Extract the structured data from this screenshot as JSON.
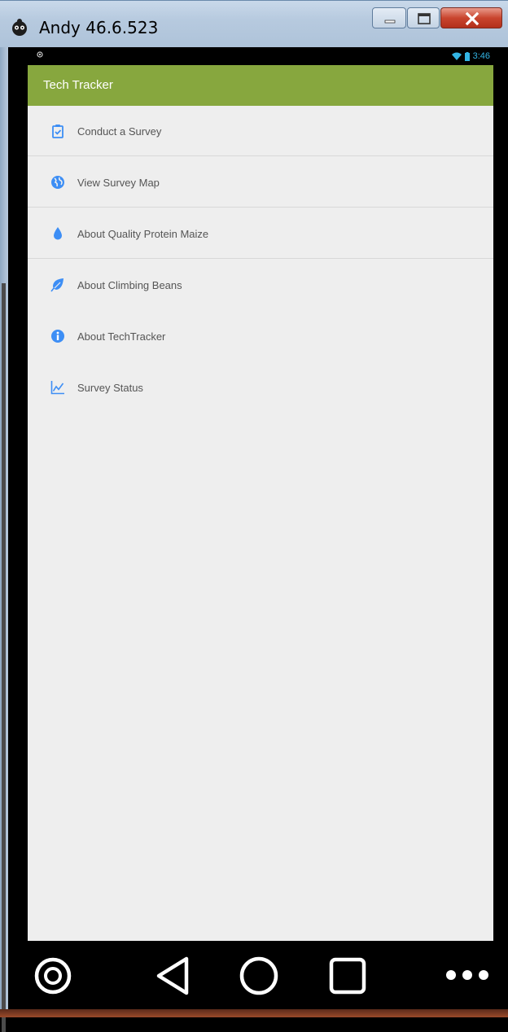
{
  "window": {
    "title": "Andy 46.6.523",
    "controls": [
      "minimize",
      "maximize",
      "close"
    ]
  },
  "statusbar": {
    "time": "3:46",
    "icons": [
      "gps-icon",
      "wifi-icon",
      "battery-icon"
    ]
  },
  "actionbar": {
    "title": "Tech Tracker",
    "color": "#87a73e"
  },
  "menu": {
    "accent_color": "#3d8ef5",
    "items": [
      {
        "label": "Conduct a Survey",
        "icon": "clipboard-check-icon"
      },
      {
        "label": "View Survey Map",
        "icon": "globe-icon"
      },
      {
        "label": "About Quality Protein Maize",
        "icon": "drop-icon"
      },
      {
        "label": "About Climbing Beans",
        "icon": "leaf-icon"
      },
      {
        "label": "About TechTracker",
        "icon": "info-icon"
      },
      {
        "label": "Survey Status",
        "icon": "line-chart-icon"
      }
    ]
  },
  "navbar": {
    "buttons": [
      "camera-icon",
      "back-icon",
      "home-icon",
      "recents-icon",
      "more-icon"
    ]
  }
}
